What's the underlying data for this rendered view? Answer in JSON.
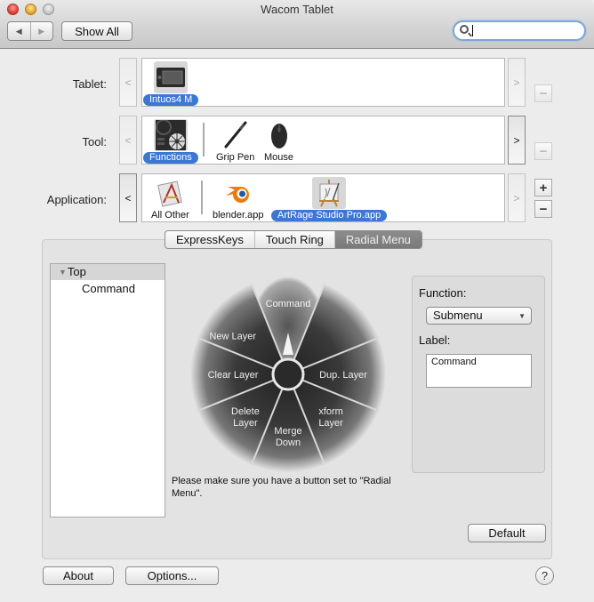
{
  "window": {
    "title": "Wacom Tablet",
    "traffic_lights": [
      "close",
      "minimize",
      "zoom"
    ]
  },
  "toolbar": {
    "back_icon": "◀",
    "forward_icon": "▶",
    "show_all_label": "Show All",
    "search": {
      "value": "",
      "placeholder": ""
    }
  },
  "selectors": {
    "tablet": {
      "label": "Tablet:",
      "items": [
        {
          "label": "Intuos4 M",
          "icon": "tablet-icon",
          "selected": true
        }
      ]
    },
    "tool": {
      "label": "Tool:",
      "items": [
        {
          "label": "Functions",
          "icon": "functions-icon",
          "selected": true
        },
        {
          "label": "Grip Pen",
          "icon": "pen-icon",
          "selected": false
        },
        {
          "label": "Mouse",
          "icon": "mouse-icon",
          "selected": false
        }
      ]
    },
    "application": {
      "label": "Application:",
      "items": [
        {
          "label": "All Other",
          "icon": "all-other-apps-icon",
          "selected": false
        },
        {
          "label": "blender.app",
          "icon": "blender-icon",
          "selected": false
        },
        {
          "label": "ArtRage Studio Pro.app",
          "icon": "artrage-icon",
          "selected": true
        }
      ]
    },
    "scroll_left": "<",
    "scroll_right": ">",
    "add": "+",
    "remove": "−"
  },
  "tabs": [
    {
      "label": "ExpressKeys",
      "active": false
    },
    {
      "label": "Touch Ring",
      "active": false
    },
    {
      "label": "Radial Menu",
      "active": true
    }
  ],
  "tree": {
    "root": "Top",
    "children": [
      "Command"
    ]
  },
  "radial_menu": {
    "segments": [
      "Command",
      "Dup. Layer",
      "xform Layer",
      "Merge Down",
      "Delete Layer",
      "Clear Layer",
      "New Layer"
    ],
    "selected": "Command",
    "note": "Please make sure you have a button set to \"Radial Menu\"."
  },
  "function_panel": {
    "function_label": "Function:",
    "function_value": "Submenu",
    "label_label": "Label:",
    "label_value": "Command"
  },
  "buttons": {
    "default": "Default",
    "about": "About",
    "options": "Options...",
    "help": "?"
  }
}
